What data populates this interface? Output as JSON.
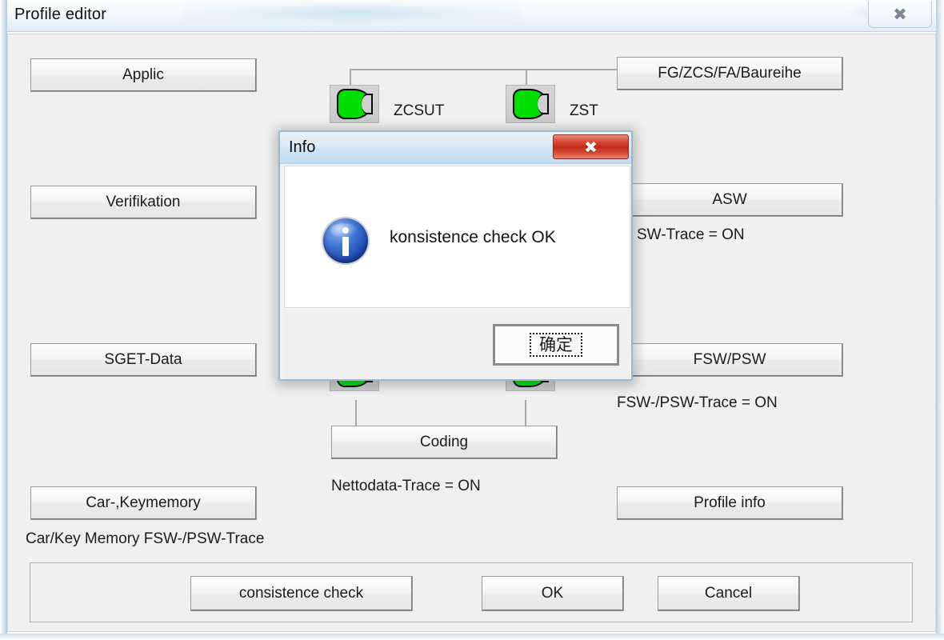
{
  "window": {
    "title": "Profile editor",
    "close_icon": "close-icon",
    "close_glyph": "✖"
  },
  "left_column": {
    "buttons": [
      {
        "label": "Applic"
      },
      {
        "label": "Verifikation"
      },
      {
        "label": "SGET-Data"
      },
      {
        "label": "Car-,Keymemory"
      }
    ],
    "carkey_trace_label": "Car/Key Memory FSW-/PSW-Trace"
  },
  "center_column": {
    "toggles": [
      {
        "label": "ZCSUT",
        "state": "on",
        "icon": "green-indicator-icon"
      },
      {
        "label": "ZST",
        "state": "on",
        "icon": "green-indicator-icon"
      }
    ],
    "coding_button": "Coding",
    "nettodata_trace_label": "Nettodata-Trace = ON"
  },
  "right_column": {
    "buttons": [
      {
        "label": "FG/ZCS/FA/Baureihe"
      },
      {
        "label": "ASW"
      },
      {
        "label": "FSW/PSW"
      },
      {
        "label": "Profile info"
      }
    ],
    "asw_trace_label": "SW-Trace = ON",
    "fsw_psw_trace_label": "FSW-/PSW-Trace = ON"
  },
  "bottom_bar": {
    "buttons": [
      {
        "label": "consistence check"
      },
      {
        "label": "OK"
      },
      {
        "label": "Cancel"
      }
    ]
  },
  "dialog": {
    "title": "Info",
    "message": "konsistence check OK",
    "ok_label": "确定",
    "close_glyph": "✖",
    "icon": "info-icon"
  },
  "colors": {
    "indicator_green": "#00dd00",
    "dialog_close_red": "#c02d18",
    "info_blue": "#1b46ab",
    "face": "#f0f0f0"
  }
}
